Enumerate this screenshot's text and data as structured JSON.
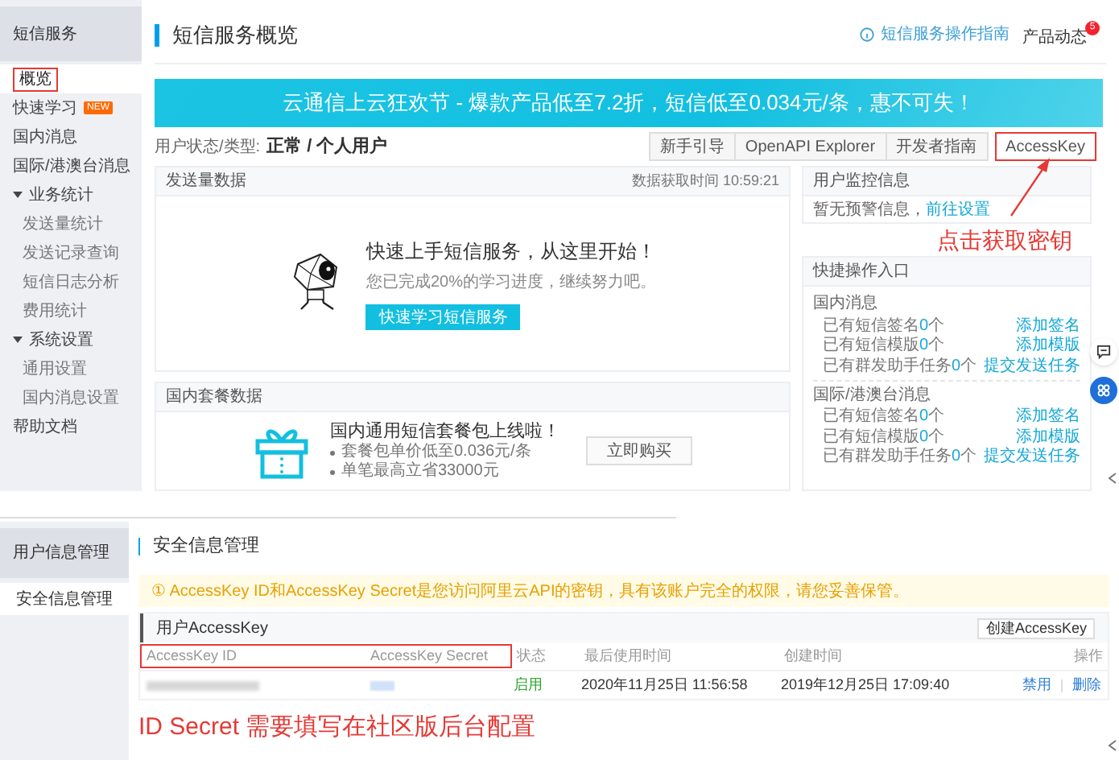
{
  "top": {
    "sidebar": {
      "title": "短信服务",
      "items": [
        {
          "label": "概览",
          "selected": true,
          "boxed": true
        },
        {
          "label": "快速学习",
          "badge": "NEW",
          "selected": false,
          "boxed": false
        },
        {
          "label": "国内消息",
          "selected": false,
          "boxed": false
        },
        {
          "label": "国际/港澳台消息",
          "selected": false,
          "boxed": false
        },
        {
          "label": "业务统计",
          "selected": false,
          "boxed": false,
          "expanded": true,
          "children": [
            {
              "label": "发送量统计",
              "selected": false
            },
            {
              "label": "发送记录查询",
              "selected": false
            },
            {
              "label": "短信日志分析",
              "selected": false
            },
            {
              "label": "费用统计",
              "selected": false
            }
          ]
        },
        {
          "label": "系统设置",
          "selected": false,
          "boxed": false,
          "expanded": true,
          "children": [
            {
              "label": "通用设置",
              "selected": false
            },
            {
              "label": "国内消息设置",
              "selected": false
            }
          ]
        },
        {
          "label": "帮助文档",
          "selected": false,
          "boxed": false
        }
      ]
    },
    "header": {
      "title": "短信服务概览",
      "guide_link": "短信服务操作指南",
      "news": "产品动态",
      "news_badge": "5"
    },
    "banner": "云通信上云狂欢节 - 爆款产品低至7.2折，短信低至0.034元/条，惠不可失！",
    "status": {
      "label": "用户状态/类型:",
      "value": "正常 / 个人用户"
    },
    "tabs": [
      {
        "label": "新手引导",
        "boxed": false
      },
      {
        "label": "OpenAPI Explorer",
        "boxed": false
      },
      {
        "label": "开发者指南",
        "boxed": false
      },
      {
        "label": "AccessKey",
        "boxed": true
      }
    ],
    "callout": "点击获取密钥",
    "send_card": {
      "title": "发送量数据",
      "time": "数据获取时间 10:59:21",
      "heading": "快速上手短信服务，从这里开始！",
      "subtitle": "您已完成20%的学习进度，继续努力吧。",
      "button": "快速学习短信服务"
    },
    "package_card": {
      "title": "国内套餐数据",
      "heading": "国内通用短信套餐包上线啦！",
      "bullets": [
        "套餐包单价低至0.036元/条",
        "单笔最高立省33000元"
      ],
      "button": "立即购买"
    },
    "monitor_card": {
      "title": "用户监控信息",
      "text": "暂无预警信息，",
      "link": "前往设置"
    },
    "quick_card": {
      "title": "快捷操作入口",
      "groups": [
        {
          "title": "国内消息",
          "rows": [
            {
              "prefix": "已有短信签名",
              "count": "0",
              "suffix": "个",
              "action": "添加签名"
            },
            {
              "prefix": "已有短信模版",
              "count": "0",
              "suffix": "个",
              "action": "添加模版"
            },
            {
              "prefix": "已有群发助手任务",
              "count": "0",
              "suffix": "个",
              "action": "提交发送任务"
            }
          ]
        },
        {
          "title": "国际/港澳台消息",
          "rows": [
            {
              "prefix": "已有短信签名",
              "count": "0",
              "suffix": "个",
              "action": "添加签名"
            },
            {
              "prefix": "已有短信模版",
              "count": "0",
              "suffix": "个",
              "action": "添加模版"
            },
            {
              "prefix": "已有群发助手任务",
              "count": "0",
              "suffix": "个",
              "action": "提交发送任务"
            }
          ]
        }
      ]
    }
  },
  "bottom": {
    "sidebar": {
      "title": "用户信息管理",
      "items": [
        {
          "label": "安全信息管理",
          "selected": true
        }
      ]
    },
    "title": "安全信息管理",
    "warning": "① AccessKey ID和AccessKey Secret是您访问阿里云API的密钥，具有该账户完全的权限，请您妥善保管。",
    "table": {
      "title": "用户AccessKey",
      "create_button": "创建AccessKey",
      "columns": [
        {
          "label": "AccessKey ID",
          "boxed": true
        },
        {
          "label": "AccessKey Secret",
          "boxed": true
        },
        {
          "label": "状态",
          "boxed": false
        },
        {
          "label": "最后使用时间",
          "boxed": false
        },
        {
          "label": "创建时间",
          "boxed": false
        },
        {
          "label": "操作",
          "boxed": false
        }
      ],
      "rows": [
        {
          "status": "启用",
          "last_used": "2020年11月25日 11:56:58",
          "created": "2019年12月25日 17:09:40",
          "actions": [
            "禁用",
            "删除"
          ]
        }
      ]
    },
    "callout": "ID Secret 需要填写在社区版后台配置"
  }
}
